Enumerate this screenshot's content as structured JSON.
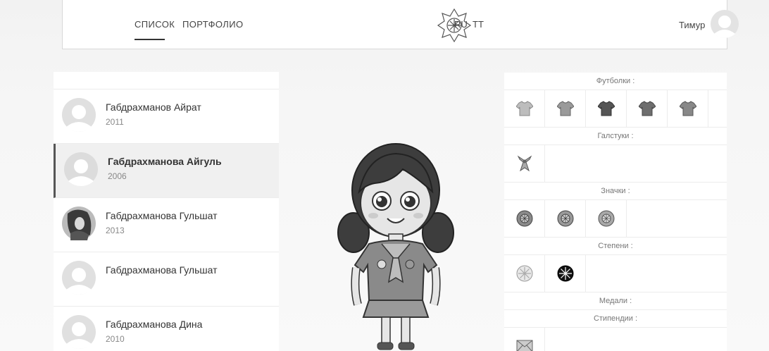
{
  "nav": {
    "list_label": "СПИСОК",
    "portfolio_label": "ПОРТФОЛИО",
    "lang_ru": "RU",
    "lang_tt": "ТТ",
    "user_name": "Тимур"
  },
  "students": [
    {
      "name": "Габдрахманов Айрат",
      "year": "2011",
      "active": false,
      "photo": false
    },
    {
      "name": "Габдрахманова Айгуль",
      "year": "2006",
      "active": true,
      "photo": false
    },
    {
      "name": "Габдрахманова Гульшат",
      "year": "2013",
      "active": false,
      "photo": true
    },
    {
      "name": "Габдрахманова Гульшат",
      "year": "",
      "active": false,
      "photo": false
    },
    {
      "name": "Габдрахманова Дина",
      "year": "2010",
      "active": false,
      "photo": false
    }
  ],
  "panel": {
    "tshirts_label": "Футболки :",
    "ties_label": "Галстуки :",
    "badges_label": "Значки :",
    "degrees_label": "Степени :",
    "medals_label": "Медали :",
    "scholarships_label": "Стипендии :"
  },
  "icons": {
    "tshirts": [
      "tshirt-icon",
      "tshirt-icon",
      "tshirt-icon",
      "tshirt-icon",
      "tshirt-icon"
    ],
    "ties": [
      "tie-icon"
    ],
    "badges": [
      "badge-icon",
      "badge-icon",
      "badge-icon"
    ],
    "degrees": [
      "degree-light-icon",
      "degree-dark-icon"
    ],
    "scholarships": [
      "envelope-icon"
    ]
  }
}
